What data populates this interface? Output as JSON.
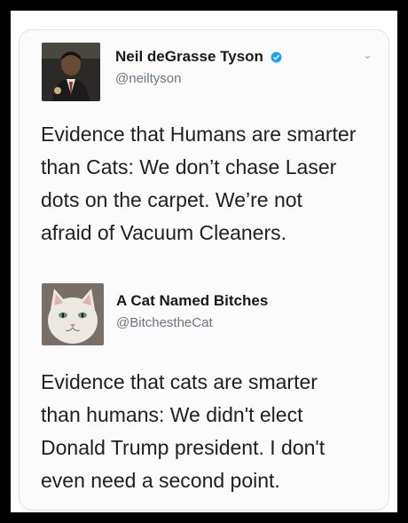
{
  "tweet1": {
    "author_name": "Neil deGrasse Tyson",
    "handle": "@neiltyson",
    "verified_icon": "verified-badge-icon",
    "lines": [
      "Evidence that Humans are smarter",
      "than Cats:  We don’t chase Laser",
      "dots on the carpet. We’re not",
      "afraid of Vacuum Cleaners."
    ]
  },
  "tweet2": {
    "author_name": "A Cat Named Bitches",
    "handle": "@BitchestheCat",
    "lines": [
      "Evidence that cats are smarter",
      "than humans: We didn't elect",
      "Donald Trump president. I don't",
      "even need a second point."
    ]
  },
  "colors": {
    "verified": "#1da1f2",
    "handle": "#6b7580",
    "text": "#1f1f1f"
  }
}
